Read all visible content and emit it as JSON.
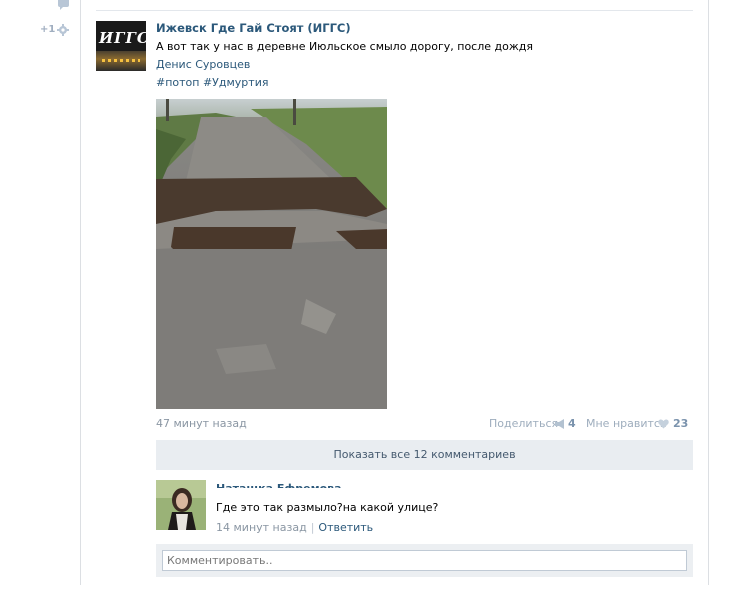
{
  "left_rail": {
    "plus_label": "+1"
  },
  "post": {
    "author": "Ижевск Где Гай Стоят (ИГГС)",
    "avatar_text": "ИГГС",
    "text": "А вот так у нас в деревне Июльское смыло дорогу, после дождя",
    "signer": "Денис Суровцев",
    "hashtags": "#потоп #Удмуртия",
    "time": "47 минут назад",
    "share_label": "Поделиться",
    "share_count": "4",
    "like_label": "Мне нравится",
    "like_count": "23",
    "show_all_comments": "Показать все 12 комментариев"
  },
  "comment": {
    "author": "Наташка Ефремова",
    "text": "Где это так размыло?на какой улице?",
    "time": "14 минут назад",
    "separator": "|",
    "reply_label": "Ответить"
  },
  "reply_box": {
    "placeholder": "Комментировать.."
  },
  "colors": {
    "link": "#2b587a",
    "muted": "#8a96a3",
    "button_bg": "#e9edf1"
  }
}
